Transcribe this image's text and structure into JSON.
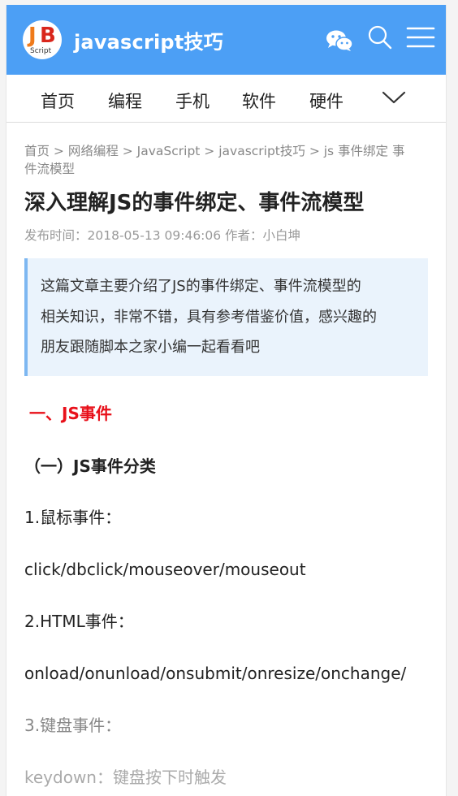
{
  "header": {
    "logo": {
      "main": "JB",
      "sub": "Script"
    },
    "site_title": "javascript技巧",
    "icons": [
      "wechat-icon",
      "search-icon",
      "menu-icon"
    ],
    "bg_color": "#4c9ff5"
  },
  "nav": {
    "items": [
      "首页",
      "编程",
      "手机",
      "软件",
      "硬件"
    ],
    "more_icon": "chevron-down-icon"
  },
  "breadcrumb": {
    "text_line1": "首页 > 网络编程 > JavaScript > javascript技巧 > js 事件绑定 事",
    "text_line2": "件流模型"
  },
  "article": {
    "title": "深入理解JS的事件绑定、事件流模型",
    "meta": "发布时间：2018-05-13 09:46:06 作者：小白坤",
    "summary": [
      "这篇文章主要介绍了JS的事件绑定、事件流模型的",
      "相关知识，非常不错，具有参考借鉴价值，感兴趣的",
      "朋友跟随脚本之家小编一起看看吧"
    ],
    "section_heading": "一、JS事件",
    "sub_heading": "（一）JS事件分类",
    "paragraphs": [
      "1.鼠标事件：",
      "click/dbclick/mouseover/mouseout",
      "2.HTML事件：",
      " onload/onunload/onsubmit/onresize/onchange/",
      "3.键盘事件：",
      " keydown：键盘按下时触发"
    ]
  },
  "colors": {
    "accent": "#4c9ff5",
    "heading_red": "#e8101a",
    "summary_bg": "#eaf3fc",
    "summary_border": "#7db7f1"
  }
}
